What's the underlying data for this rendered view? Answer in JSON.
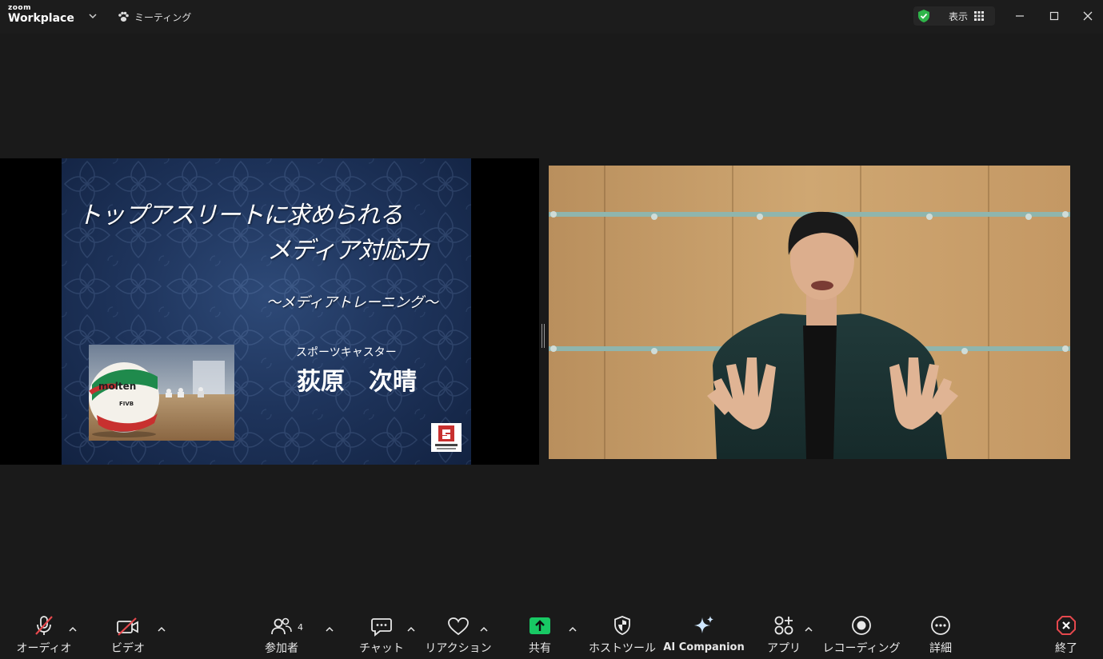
{
  "app": {
    "logo_small": "zoom",
    "logo_big": "Workplace",
    "meeting_menu_label": "ミーティング",
    "view_label": "表示"
  },
  "slide": {
    "title_line1": "トップアスリートに求められる",
    "title_line2": "メディア対応力",
    "subtitle": "〜メディアトレーニング〜",
    "role": "スポーツキャスター",
    "name": "荻原　次晴"
  },
  "toolbar": {
    "audio": "オーディオ",
    "video": "ビデオ",
    "participants": "参加者",
    "participants_count": "4",
    "chat": "チャット",
    "reactions": "リアクション",
    "share": "共有",
    "host_tools": "ホストツール",
    "ai_companion": "AI Companion",
    "apps": "アプリ",
    "record": "レコーディング",
    "more": "詳細",
    "end": "終了"
  },
  "colors": {
    "share_green": "#18c964",
    "end_red": "#e5484d",
    "muted_red": "#e5484d",
    "shield_green": "#2fb44a"
  }
}
